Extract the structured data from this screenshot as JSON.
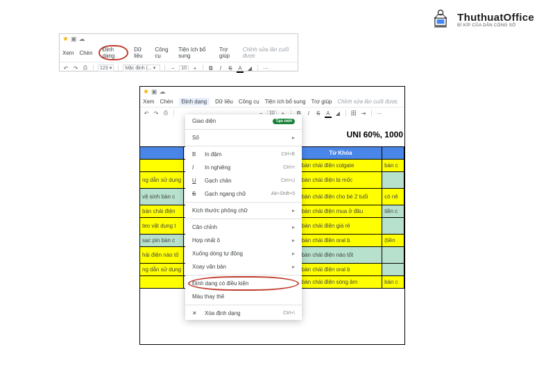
{
  "logo": {
    "title": "ThuthuatOffice",
    "sub": "BÍ KÍP CỦA DÂN CÔNG SỞ"
  },
  "panel1": {
    "menu": {
      "xem": "Xem",
      "chen": "Chèn",
      "dinhdang": "Định dạng",
      "dulieu": "Dữ liệu",
      "congcu": "Công cụ",
      "tienich": "Tiện ích bổ sung",
      "trogiup": "Trợ giúp",
      "edit": "Chỉnh sửa lần cuối được"
    },
    "toolbar": {
      "zoom": "123",
      "font": "Mặc định (...",
      "size": "10",
      "bold": "B",
      "italic": "I",
      "strike": "S",
      "textcolor": "A"
    }
  },
  "panel2": {
    "menu": {
      "xem": "Xem",
      "chen": "Chèn",
      "dinhdang": "Định dạng",
      "dulieu": "Dữ liệu",
      "congcu": "Công cụ",
      "tienich": "Tiện ích bổ sung",
      "trogiup": "Trợ giúp",
      "edit": "Chỉnh sửa lần cuối được"
    },
    "toolbar": {
      "zoom": "",
      "size": "10",
      "bold": "B",
      "italic": "I",
      "strike": "S",
      "textcolor": "A"
    },
    "dropdown": {
      "giaodien": "Giao diện",
      "pill": "Tạo mới",
      "so": "Số",
      "indam": "In đậm",
      "sc_b": "Ctrl+B",
      "innghieng": "In nghiêng",
      "sc_i": "Ctrl+I",
      "gachchan": "Gạch chân",
      "sc_u": "Ctrl+U",
      "gachngang": "Gạch ngang chữ",
      "sc_s": "Alt+Shift+5",
      "kichthuoc": "Kích thước phông chữ",
      "canchinh": "Căn chỉnh",
      "hopnhat": "Hợp nhất ô",
      "xuongdong": "Xuống dòng tự động",
      "xoayvb": "Xoay văn bản",
      "dieukien": "Định dạng có điều kiện",
      "mauthaythe": "Màu thay thế",
      "xoadd": "Xóa định dạng",
      "sc_clear": "Ctrl+\\"
    },
    "sheet": {
      "title": "UNI 60%, 1000",
      "header": {
        "colC": "Từ Khóa"
      },
      "rows": [
        {
          "a": "",
          "c": "bàn chải điện colgate",
          "d": "bàn c",
          "bgA": "yellow",
          "bgC": "yellow",
          "bgD": "yellow"
        },
        {
          "a": "ng dẫn sử dụng",
          "c": "bàn chải điện bị mốc",
          "d": "",
          "bgA": "yellow",
          "bgC": "yellow",
          "bgD": "green",
          "sep": true
        },
        {
          "a": "vệ sinh bàn c",
          "c": "bàn chải điện cho bé 2 tuổi",
          "d": "có nê",
          "bgA": "green",
          "bgC": "yellow",
          "bgD": "yellow",
          "sep": true
        },
        {
          "a": "bàn chải điện",
          "c": "bàn chải điện mua ở đâu",
          "d": "tiền c",
          "bgA": "yellow",
          "bgC": "yellow",
          "bgD": "green"
        },
        {
          "a": "teo vật dụng t",
          "c": "bàn chải điện giá rẻ",
          "d": "",
          "bgA": "yellow",
          "bgC": "yellow",
          "bgD": "green",
          "sep": true
        },
        {
          "a": "sạc pin bàn c",
          "c": "bàn chải điện oral b",
          "d": "(tiền",
          "bgA": "green",
          "bgC": "yellow",
          "bgD": "yellow"
        },
        {
          "a": "hải điện nào tố",
          "c": "bàn chải điện nào tốt",
          "d": "",
          "bgA": "yellow",
          "bgC": "green",
          "bgD": "green",
          "sep": true
        },
        {
          "a": "ng dẫn sử dụng",
          "c": "bàn chải điện oral b",
          "d": "",
          "bgA": "yellow",
          "bgC": "yellow",
          "bgD": "green"
        },
        {
          "a": "",
          "c": "bàn chải điện sóng âm",
          "d": "bàn c",
          "bgA": "yellow",
          "bgC": "yellow",
          "bgD": "yellow"
        }
      ]
    }
  }
}
